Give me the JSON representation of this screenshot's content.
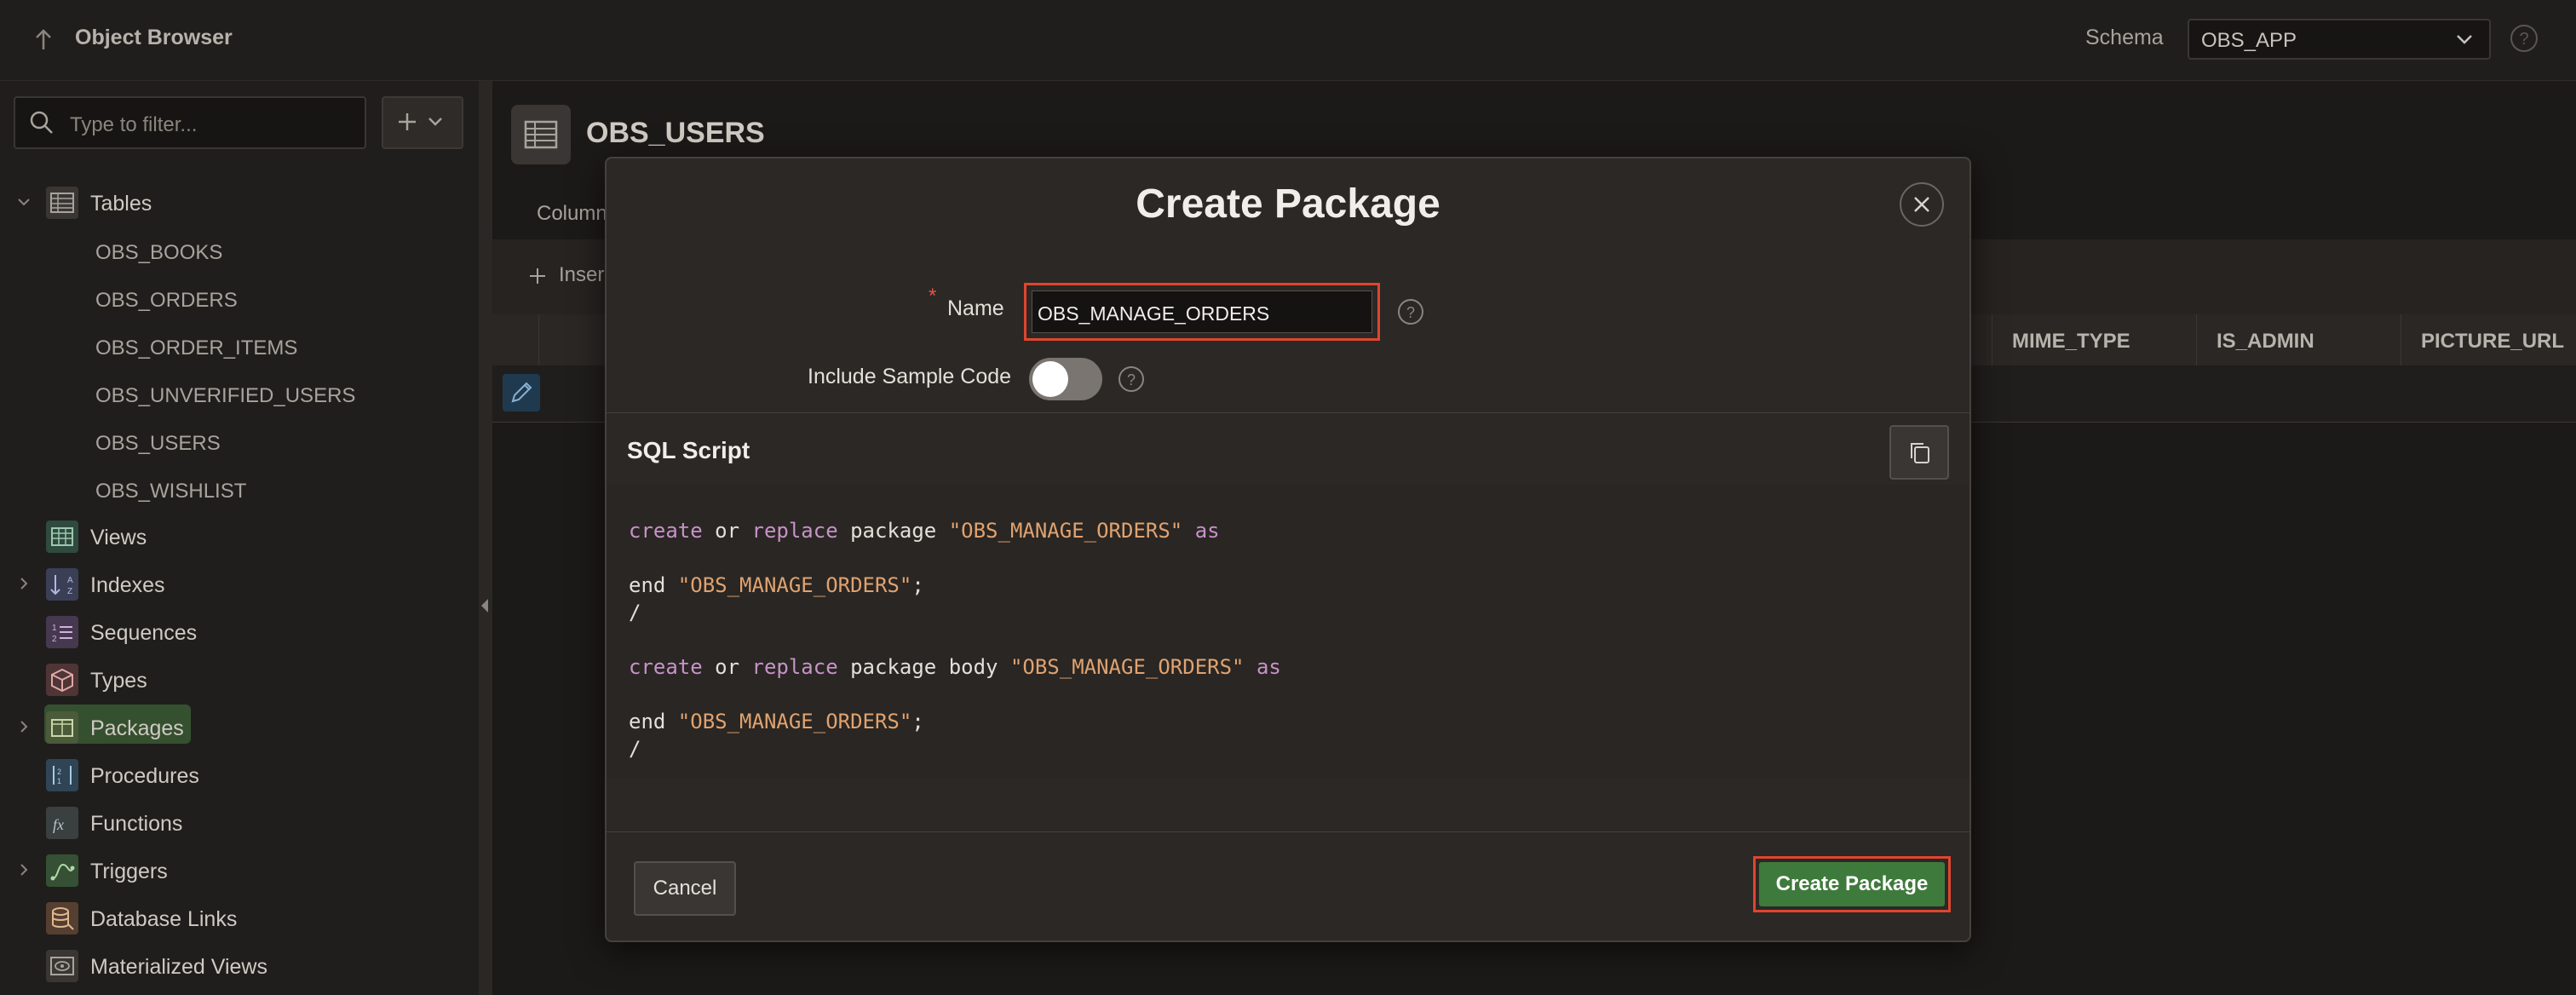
{
  "header": {
    "title": "Object Browser",
    "schema_label": "Schema",
    "schema_value": "OBS_APP"
  },
  "sidebar": {
    "filter_placeholder": "Type to filter...",
    "groups": [
      {
        "label": "Tables",
        "icon": "table-icon"
      },
      {
        "label": "Views",
        "icon": "view-icon"
      },
      {
        "label": "Indexes",
        "icon": "index-icon"
      },
      {
        "label": "Sequences",
        "icon": "sequence-icon"
      },
      {
        "label": "Types",
        "icon": "type-icon"
      },
      {
        "label": "Packages",
        "icon": "package-icon"
      },
      {
        "label": "Procedures",
        "icon": "procedure-icon"
      },
      {
        "label": "Functions",
        "icon": "function-icon"
      },
      {
        "label": "Triggers",
        "icon": "trigger-icon"
      },
      {
        "label": "Database Links",
        "icon": "database-link-icon"
      },
      {
        "label": "Materialized Views",
        "icon": "materialized-view-icon"
      }
    ],
    "tables": [
      "OBS_BOOKS",
      "OBS_ORDERS",
      "OBS_ORDER_ITEMS",
      "OBS_UNVERIFIED_USERS",
      "OBS_USERS",
      "OBS_WISHLIST"
    ]
  },
  "main": {
    "object_title": "OBS_USERS",
    "tab_partial": "Column",
    "insert_partial": "Inser",
    "columns": [
      "MIME_TYPE",
      "IS_ADMIN",
      "PICTURE_URL"
    ]
  },
  "modal": {
    "title": "Create Package",
    "name_label": "Name",
    "name_value": "OBS_MANAGE_ORDERS",
    "required_marker": "*",
    "include_sample_label": "Include Sample Code",
    "include_sample_on": false,
    "sql_section_title": "SQL Script",
    "code_lines": {
      "l1_kw1": "create",
      "l1_t1": " or ",
      "l1_kw2": "replace",
      "l1_t2": " package ",
      "l1_str": "\"OBS_MANAGE_ORDERS\"",
      "l1_t3": " as",
      "l2_t": "end ",
      "l2_str": "\"OBS_MANAGE_ORDERS\"",
      "l2_end": ";",
      "l3": "/",
      "l4_kw1": "create",
      "l4_t1": " or ",
      "l4_kw2": "replace",
      "l4_t2": " package body ",
      "l4_str": "\"OBS_MANAGE_ORDERS\"",
      "l4_t3": " as",
      "l5_t": "end ",
      "l5_str": "\"OBS_MANAGE_ORDERS\"",
      "l5_end": ";",
      "l6": "/"
    },
    "cancel_label": "Cancel",
    "create_label": "Create Package"
  },
  "colors": {
    "accent_green": "#3f7a3d",
    "highlight_red": "#e0452e",
    "keyword": "#c792c8",
    "string": "#e0a270"
  }
}
